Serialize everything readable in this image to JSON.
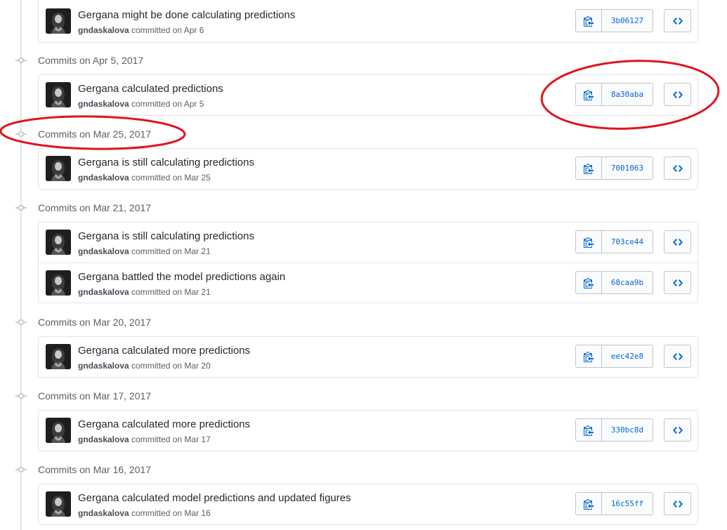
{
  "colors": {
    "link": "#0366d6",
    "text": "#24292e",
    "muted": "#586069",
    "border": "#e1e4e8",
    "annotation": "#e0141e"
  },
  "icons": {
    "node": "git-commit-icon",
    "copy": "clippy-icon",
    "browse": "code-icon",
    "avatar": "user-avatar"
  },
  "groups": [
    {
      "date": "",
      "commits": [
        {
          "message": "Gergana might be done calculating predictions",
          "author": "gndaskalova",
          "committed": "committed on Apr 6",
          "sha": "3b06127"
        }
      ]
    },
    {
      "date": "Commits on Apr 5, 2017",
      "commits": [
        {
          "message": "Gergana calculated predictions",
          "author": "gndaskalova",
          "committed": "committed on Apr 5",
          "sha": "8a30aba"
        }
      ]
    },
    {
      "date": "Commits on Mar 25, 2017",
      "commits": [
        {
          "message": "Gergana is still calculating predictions",
          "author": "gndaskalova",
          "committed": "committed on Mar 25",
          "sha": "7001063"
        }
      ]
    },
    {
      "date": "Commits on Mar 21, 2017",
      "commits": [
        {
          "message": "Gergana is still calculating predictions",
          "author": "gndaskalova",
          "committed": "committed on Mar 21",
          "sha": "703ce44"
        },
        {
          "message": "Gergana battled the model predictions again",
          "author": "gndaskalova",
          "committed": "committed on Mar 21",
          "sha": "68caa9b"
        }
      ]
    },
    {
      "date": "Commits on Mar 20, 2017",
      "commits": [
        {
          "message": "Gergana calculated more predictions",
          "author": "gndaskalova",
          "committed": "committed on Mar 20",
          "sha": "eec42e8"
        }
      ]
    },
    {
      "date": "Commits on Mar 17, 2017",
      "commits": [
        {
          "message": "Gergana calculated more predictions",
          "author": "gndaskalova",
          "committed": "committed on Mar 17",
          "sha": "330bc8d"
        }
      ]
    },
    {
      "date": "Commits on Mar 16, 2017",
      "commits": [
        {
          "message": "Gergana calculated model predictions and updated figures",
          "author": "gndaskalova",
          "committed": "committed on Mar 16",
          "sha": "16c55ff"
        }
      ]
    }
  ]
}
